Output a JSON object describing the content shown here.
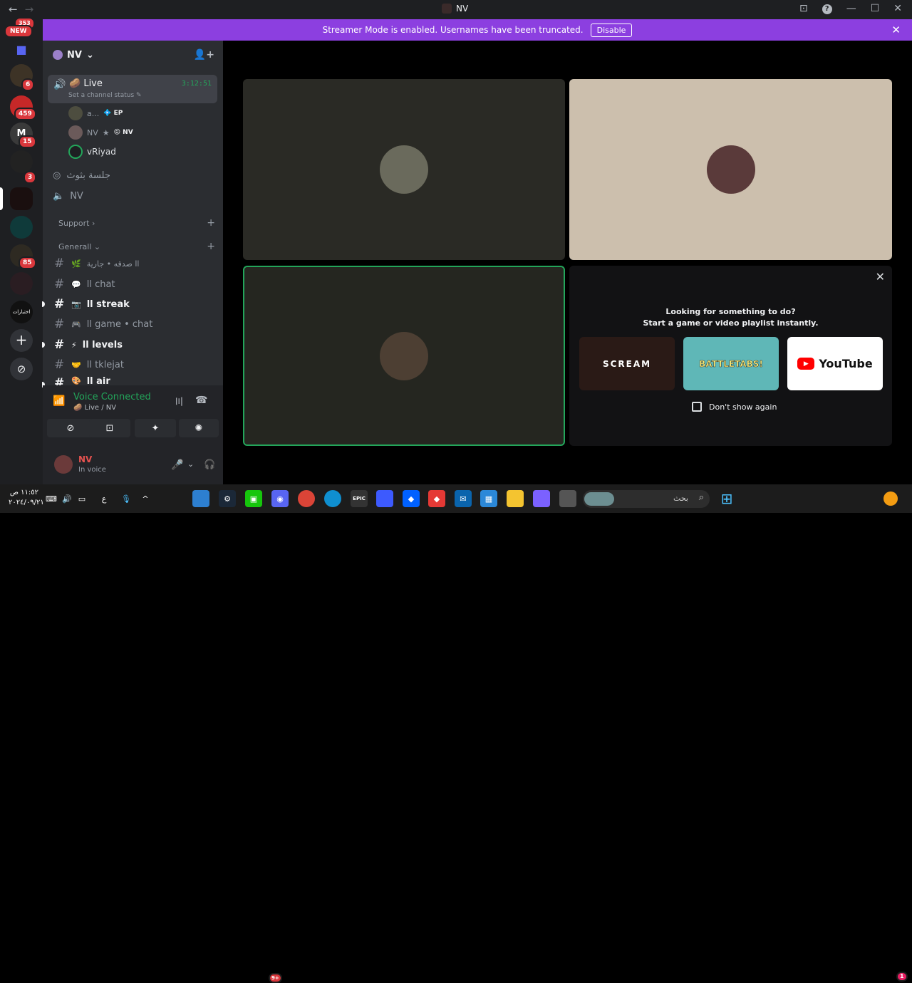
{
  "window": {
    "title": "NV",
    "back": "←",
    "forward": "→",
    "help": "?",
    "minimize": "—",
    "maximize": "☐",
    "close": "✕"
  },
  "guilds": {
    "top_badge": "353",
    "new_label": "NEW",
    "badges": [
      "6",
      "459",
      "15",
      "3",
      "85"
    ],
    "label_server": "اختبارات",
    "add_server": "+",
    "discover": "⊘"
  },
  "banner": {
    "text": "Streamer Mode is enabled. Usernames have been truncated.",
    "button": "Disable"
  },
  "server": {
    "name": "NV",
    "chevron": "⌄"
  },
  "live_channel": {
    "emoji": "🥔",
    "name": "Live",
    "timer": "3:12:51",
    "status": "Set a channel status",
    "pencil": "✎"
  },
  "voice_users": [
    {
      "name": "a...",
      "tag": "EP",
      "tag_prefix": "💠"
    },
    {
      "name": "NV",
      "star": "★",
      "tag": "NV",
      "tag_prefix": "😝"
    },
    {
      "name": "vRiyad"
    }
  ],
  "voice_channels": [
    {
      "name": "جلسة بثوث"
    },
    {
      "name": "NV"
    }
  ],
  "categories": [
    {
      "name": "Support",
      "chevron": "›"
    },
    {
      "name": "Generall",
      "chevron": "⌄"
    }
  ],
  "text_channels": [
    {
      "emoji": "🌿",
      "name": "اا صدقه • جارية",
      "unread": false
    },
    {
      "emoji": "💬",
      "name": "اا chat",
      "unread": false
    },
    {
      "emoji": "📷",
      "name": "اا streak",
      "unread": true
    },
    {
      "emoji": "🎮",
      "name": "اا game • chat",
      "unread": false
    },
    {
      "emoji": "⚡",
      "name": "اا levels",
      "unread": true
    },
    {
      "emoji": "🤝",
      "name": "اا tklejat",
      "unread": false
    },
    {
      "emoji": "🎨",
      "name": "اا air",
      "unread": true
    }
  ],
  "voice_panel": {
    "status": "Voice Connected",
    "sub_emoji": "🥔",
    "sub": "Live / NV",
    "buttons": [
      "⊘",
      "⊡",
      "✦",
      "✺"
    ]
  },
  "user": {
    "name": "NV",
    "status": "In voice"
  },
  "activity": {
    "line1": "Looking for something to do?",
    "line2": "Start a game or video playlist instantly.",
    "cards": [
      "SCREAM",
      "BATTLETABS!",
      "YouTube"
    ],
    "checkbox": "Don't show again",
    "close": "✕"
  },
  "taskbar": {
    "time": "١١:٥٢ ص",
    "date": "٢٠٢٤/٠٩/٢١",
    "lang": "ع",
    "search_placeholder": "بحث",
    "discord_badge": "9+",
    "epic": "EPIC",
    "notif_badge": "1"
  },
  "colors": {
    "accent": "#8c3fe0",
    "voice_green": "#23a55a",
    "badge_red": "#da373c"
  }
}
